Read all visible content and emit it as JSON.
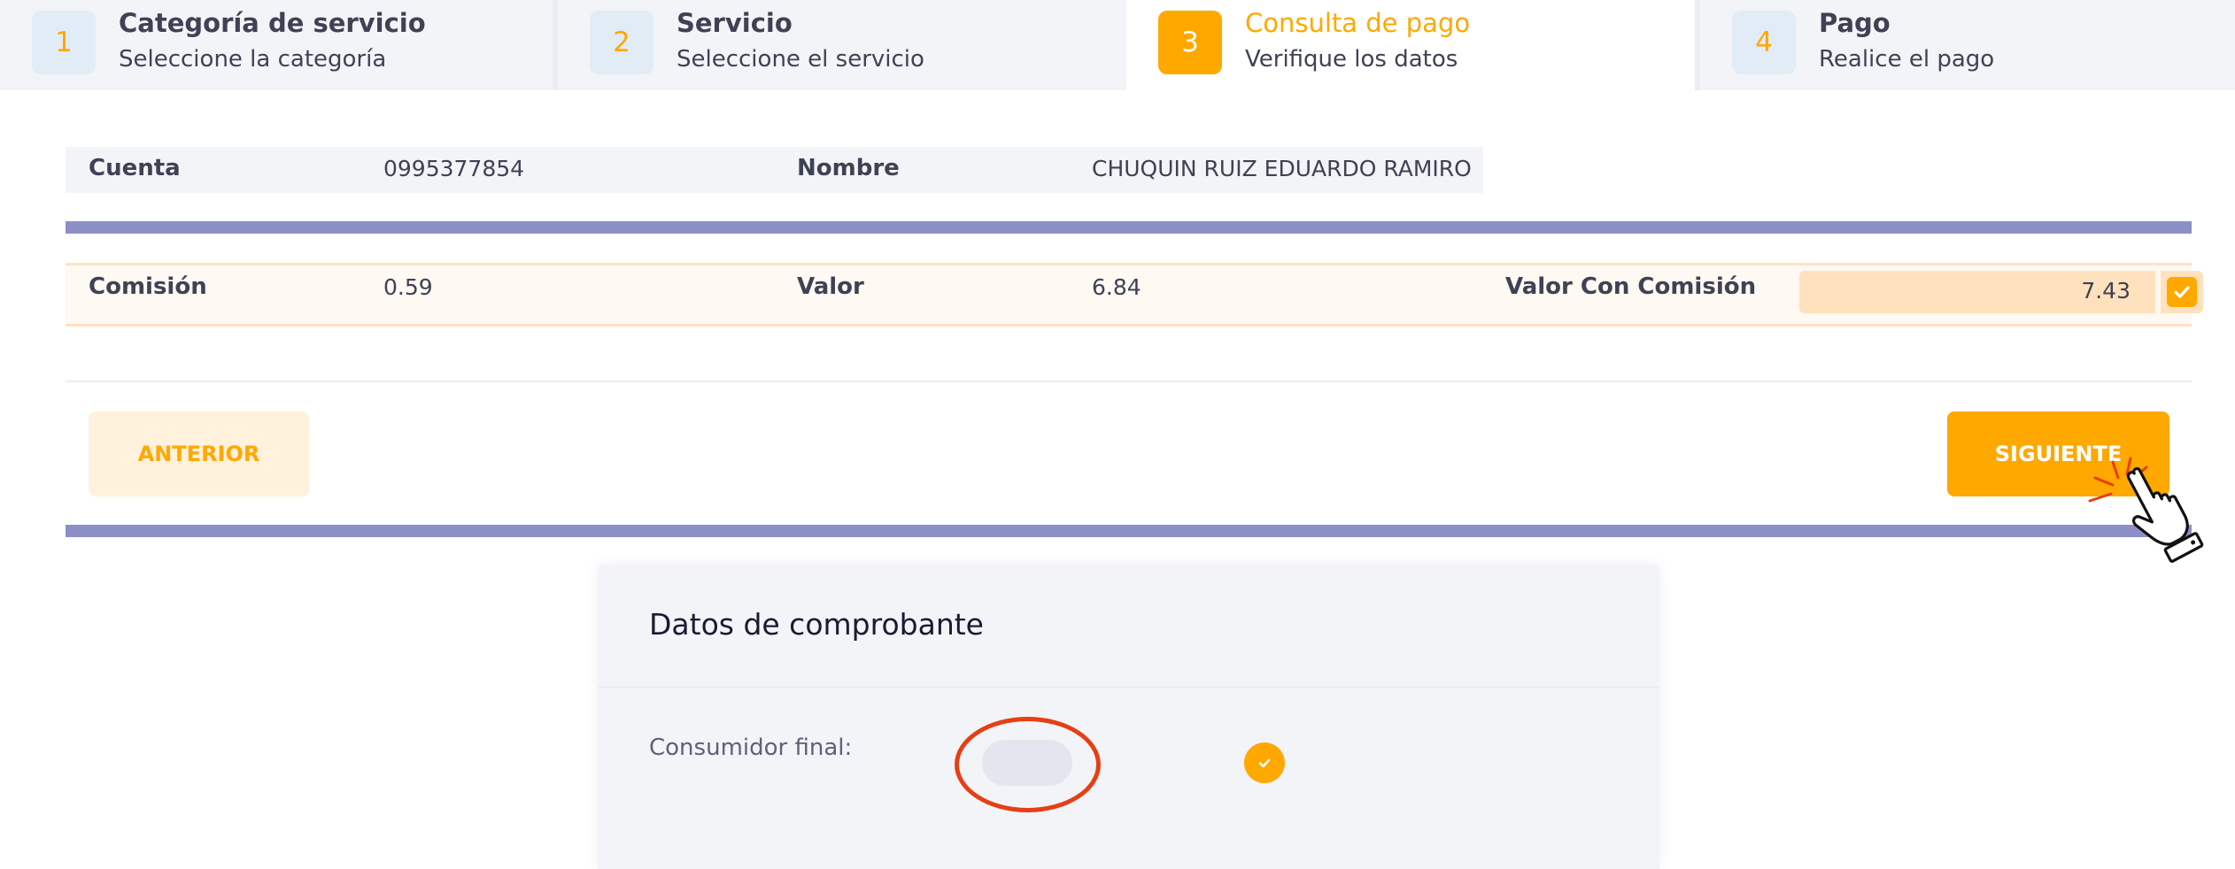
{
  "steps": [
    {
      "number": "1",
      "title": "Categoría de servicio",
      "subtitle": "Seleccione la categoría"
    },
    {
      "number": "2",
      "title": "Servicio",
      "subtitle": "Seleccione el servicio"
    },
    {
      "number": "3",
      "title": "Consulta de pago",
      "subtitle": "Verifique los datos"
    },
    {
      "number": "4",
      "title": "Pago",
      "subtitle": "Realice el pago"
    }
  ],
  "active_step": 3,
  "account": {
    "cuenta_label": "Cuenta",
    "cuenta_value": "0995377854",
    "nombre_label": "Nombre",
    "nombre_value": "CHUQUIN RUIZ EDUARDO RAMIRO"
  },
  "payment": {
    "comision_label": "Comisión",
    "comision_value": "0.59",
    "valor_label": "Valor",
    "valor_value": "6.84",
    "total_label": "Valor Con Comisión",
    "total_value": "7.43",
    "total_checked": true
  },
  "buttons": {
    "prev_label": "ANTERIOR",
    "next_label": "SIGUIENTE"
  },
  "receipt": {
    "title": "Datos de comprobante",
    "consumidor_label": "Consumidor final:",
    "consumidor_final": true
  },
  "colors": {
    "accent": "#ffa800",
    "separator_bar": "#8c8fc7",
    "highlight_ring": "#e53f14"
  },
  "icons": {
    "checkbox": "check-icon",
    "toggle_knob": "check-icon",
    "cursor": "hand-pointer-icon"
  }
}
